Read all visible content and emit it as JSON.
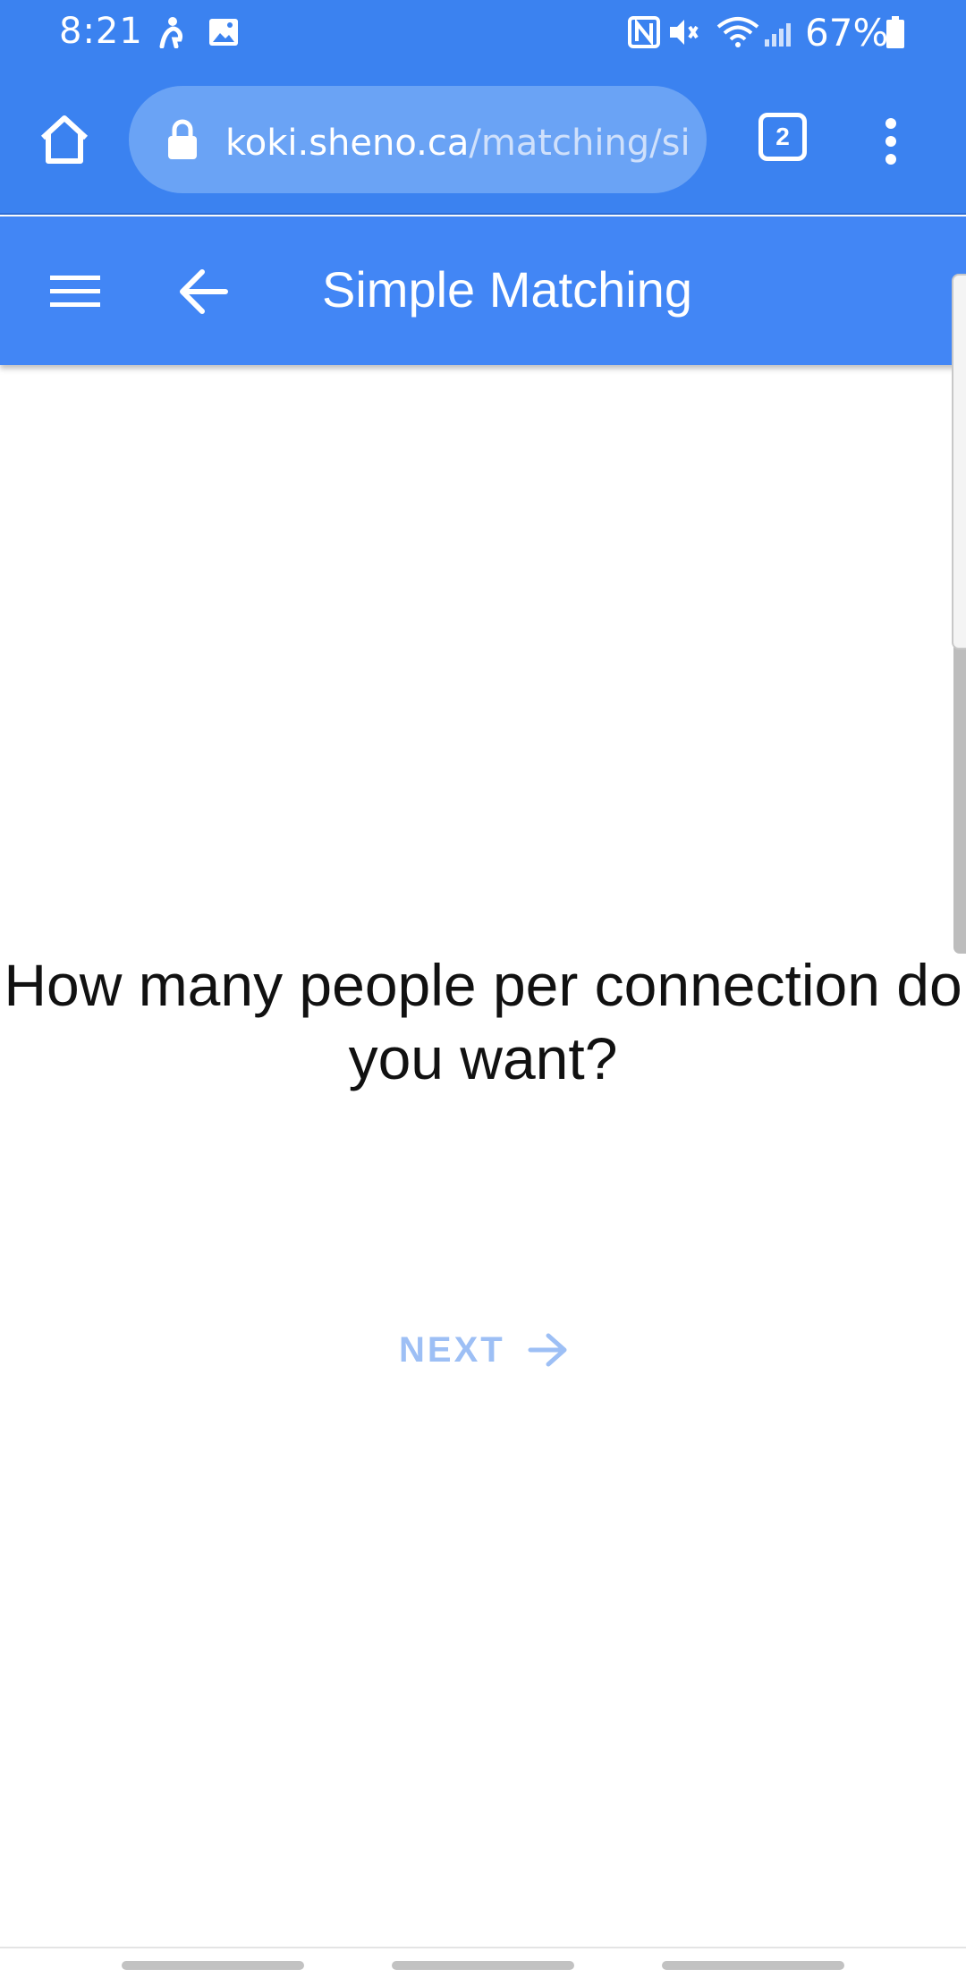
{
  "status_bar": {
    "time": "8:21",
    "battery_percent": "67%",
    "icons": [
      "accessibility-icon",
      "image-icon",
      "nfc-icon",
      "mute-icon",
      "wifi-icon",
      "signal-icon",
      "battery-icon"
    ]
  },
  "browser": {
    "url_domain": "koki.sheno.ca",
    "url_path": "/matching/simple",
    "tab_count": "2"
  },
  "app_bar": {
    "title": "Simple Matching"
  },
  "main": {
    "question": "How many people per connection do you want?",
    "next_label": "NEXT"
  },
  "colors": {
    "browser_bar": "#3b82f0",
    "app_bar": "#4286f5",
    "next_disabled": "#9dbff5"
  }
}
